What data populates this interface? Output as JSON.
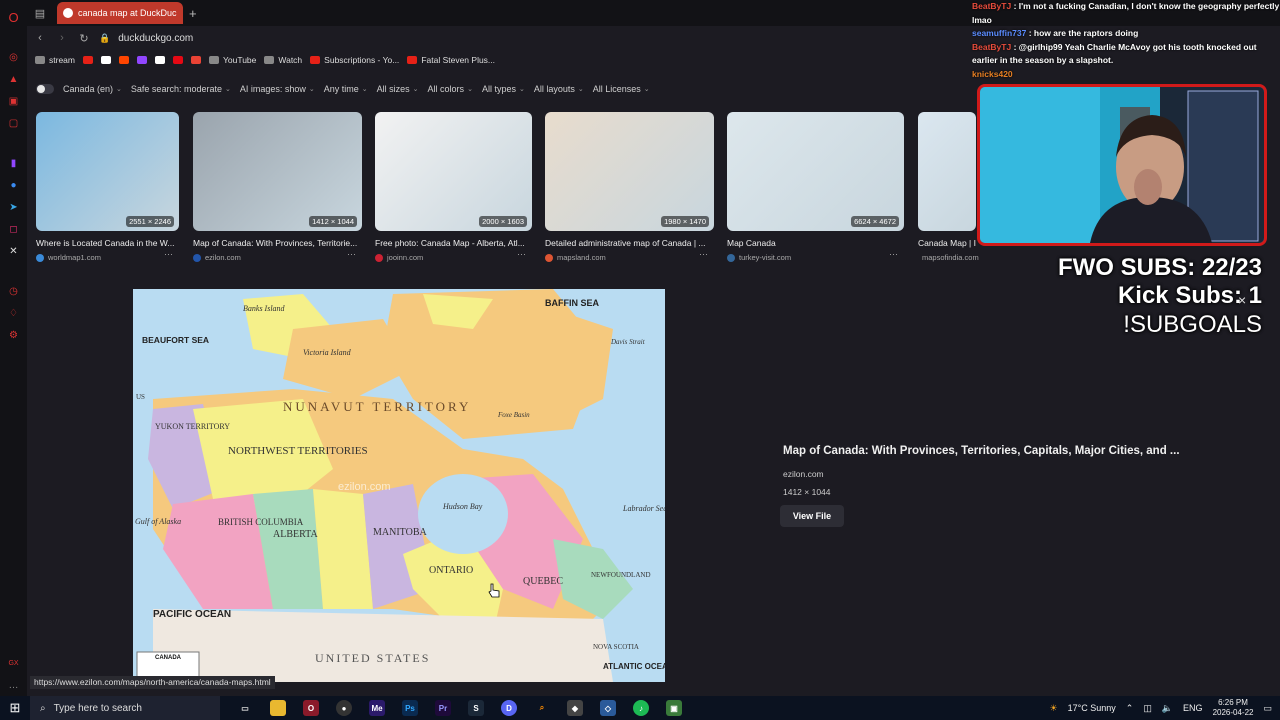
{
  "browser": {
    "tab_title": "canada map at DuckDuckGo",
    "new_tab": "+",
    "url": "duckduckgo.com"
  },
  "bookmarks": [
    {
      "label": "stream",
      "color": "#888888"
    },
    {
      "label": "",
      "color": "#e62117"
    },
    {
      "label": "",
      "color": "#ffffff"
    },
    {
      "label": "",
      "color": "#ff4500"
    },
    {
      "label": "",
      "color": "#9146ff"
    },
    {
      "label": "",
      "color": "#ffffff"
    },
    {
      "label": "",
      "color": "#e50914"
    },
    {
      "label": "",
      "color": "#ea4335"
    },
    {
      "label": "YouTube",
      "color": "#888888"
    },
    {
      "label": "Watch",
      "color": "#888888"
    },
    {
      "label": "Subscriptions - Yo...",
      "color": "#e62117"
    },
    {
      "label": "Fatal Steven Plus...",
      "color": "#e62117"
    }
  ],
  "filters": [
    "Canada (en)",
    "Safe search: moderate",
    "AI images: show",
    "Any time",
    "All sizes",
    "All colors",
    "All types",
    "All layouts",
    "All Licenses"
  ],
  "thumbnails": [
    {
      "caption": "Where is Located Canada in the W...",
      "source": "worldmap1.com",
      "dims": "2551 × 2246",
      "color": "#7bb8e0",
      "src_color": "#3a8ad8"
    },
    {
      "caption": "Map of Canada: With Provinces, Territorie...",
      "source": "ezilon.com",
      "dims": "1412 × 1044",
      "color": "#9aa4ad",
      "src_color": "#2255aa"
    },
    {
      "caption": "Free photo: Canada Map - Alberta, Atl...",
      "source": "jooinn.com",
      "dims": "2000 × 1603",
      "color": "#f2f2f2",
      "src_color": "#cc2233"
    },
    {
      "caption": "Detailed administrative map of Canada | ...",
      "source": "mapsland.com",
      "dims": "1980 × 1470",
      "color": "#e8dccd",
      "src_color": "#dd5533"
    },
    {
      "caption": "Map Canada",
      "source": "turkey-visit.com",
      "dims": "6624 × 4672",
      "color": "#dde7ec",
      "src_color": "#336699"
    },
    {
      "caption": "Canada Map | I...",
      "source": "mapsofindia.com",
      "dims": "",
      "color": "#dbe7f0",
      "src_color": "#4477aa"
    }
  ],
  "preview": {
    "map_labels": {
      "baffin_sea": "BAFFIN SEA",
      "beaufort_sea": "BEAUFORT SEA",
      "banks": "Banks Island",
      "victoria": "Victoria Island",
      "nunavut": "NUNAVUT TERRITORY",
      "yukon": "YUKON TERRITORY",
      "nwt": "NORTHWEST TERRITORIES",
      "hudson": "Hudson Bay",
      "labrador": "Labrador Sea",
      "bc": "BRITISH COLUMBIA",
      "alberta": "ALBERTA",
      "manitoba": "MANITOBA",
      "ontario": "ONTARIO",
      "quebec": "QUEBEC",
      "newfoundland": "NEWFOUNDLAND",
      "pacific": "PACIFIC OCEAN",
      "atlantic": "ATLANTIC OCEAN",
      "united_states": "UNITED STATES",
      "alaska": "Gulf of Alaska",
      "nova_scotia": "NOVA SCOTIA",
      "canada_box": "CANADA",
      "us": "US",
      "davis": "Davis Strait",
      "foxe": "Foxe Basin",
      "watermark": "ezilon.com"
    },
    "title": "Map of Canada: With Provinces, Territories, Capitals, Major Cities, and ...",
    "source": "ezilon.com",
    "dims": "1412 × 1044",
    "view_file": "View File"
  },
  "chat": [
    {
      "user": "BeatByTJ",
      "msg": "I'm not a fucking Canadian, I don't know the geography perfectly lmao"
    },
    {
      "user": "seamuffin737",
      "msg": "how are the raptors doing"
    },
    {
      "user": "BeatByTJ",
      "msg": "@girlhip99 Yeah Charlie McAvoy got his tooth knocked out earlier in the season by a slapshot."
    },
    {
      "user": "knicks420",
      "msg": ""
    }
  ],
  "overlay": {
    "line1": "FWO SUBS: 22/23",
    "line2": "Kick Subs: 1",
    "line3": "!SUBGOALS",
    "close": "×"
  },
  "status_url": "https://www.ezilon.com/maps/north-america/canada-maps.html",
  "taskbar": {
    "search_placeholder": "Type here to search",
    "weather": "17°C  Sunny",
    "lang": "ENG",
    "time": "6:26 PM",
    "date": "2026-04-22"
  }
}
